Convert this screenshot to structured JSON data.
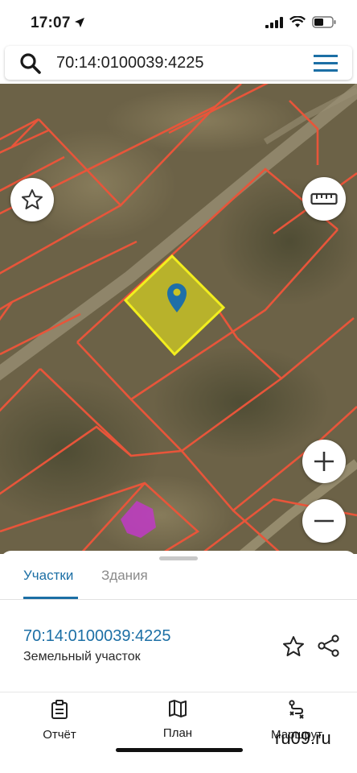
{
  "status": {
    "time": "17:07"
  },
  "search": {
    "query": "70:14:0100039:4225"
  },
  "map": {
    "icons": [
      "star-icon",
      "ruler-icon",
      "plus-icon",
      "minus-icon",
      "layers-icon",
      "location-arrow-icon",
      "map-pin-icon"
    ],
    "colors": {
      "boundary": "#e8553a",
      "selected_fill": "#c9c425",
      "selected_outline": "#f2ee1e",
      "pin": "#1e6fa8",
      "marker": "#c03ac6"
    }
  },
  "tabs": [
    {
      "label": "Участки",
      "active": true
    },
    {
      "label": "Здания",
      "active": false
    }
  ],
  "result": {
    "cadastral_number": "70:14:0100039:4225",
    "type": "Земельный участок"
  },
  "bottom_nav": [
    {
      "label": "Отчёт",
      "icon": "clipboard-icon"
    },
    {
      "label": "План",
      "icon": "map-icon"
    },
    {
      "label": "Маршрут",
      "icon": "route-icon"
    }
  ],
  "watermark": "ru09.ru",
  "accent_color": "#1c6fa5"
}
